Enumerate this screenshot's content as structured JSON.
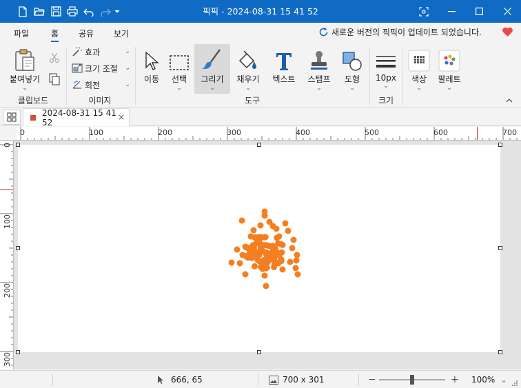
{
  "titlebar": {
    "title": "픽픽 - 2024-08-31 15 41 52"
  },
  "menu": {
    "tabs": [
      "파일",
      "홈",
      "공유",
      "보기"
    ],
    "active_tab": "홈",
    "update_notice": "새로운 버전의 픽픽이 업데이트 되었습니다."
  },
  "ribbon": {
    "paste_label": "붙여넣기",
    "clipboard_group": "클립보드",
    "image_group": "이미지",
    "effect_label": "효과",
    "resize_label": "크기 조절",
    "rotate_label": "회전",
    "tools_group": "도구",
    "move_label": "이동",
    "select_label": "선택",
    "draw_label": "그리기",
    "fill_label": "채우기",
    "text_label": "텍스트",
    "stamp_label": "스탬프",
    "shape_label": "도형",
    "size_group": "크기",
    "size_value": "10px",
    "color_label": "색상",
    "palette_label": "팔레트"
  },
  "document_tab": {
    "name": "2024-08-31 15 41 52"
  },
  "ruler": {
    "h_labels": [
      "0",
      "100",
      "200",
      "300",
      "400",
      "500",
      "600",
      "700"
    ],
    "v_labels": [
      "0",
      "100",
      "200",
      "300"
    ]
  },
  "status": {
    "cursor_pos": "666, 65",
    "image_size": "700 x 301",
    "zoom": "100%"
  },
  "colors": {
    "accent": "#0f6bc4",
    "dot_color": "#f47e20"
  }
}
